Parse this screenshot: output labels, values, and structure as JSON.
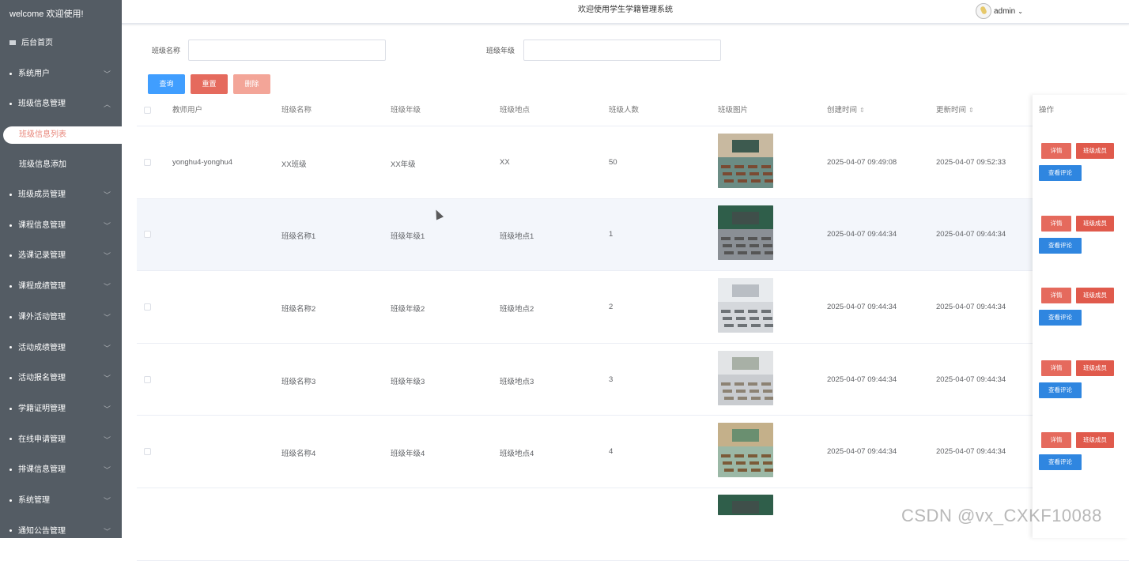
{
  "sidebar": {
    "welcome": "welcome 欢迎使用!",
    "items": [
      {
        "label": "后台首页",
        "icon": "home-icon",
        "expandable": false
      },
      {
        "label": "系统用户",
        "expandable": true,
        "expanded": false
      },
      {
        "label": "班级信息管理",
        "expandable": true,
        "expanded": true,
        "children": [
          {
            "label": "班级信息列表",
            "active": true
          },
          {
            "label": "班级信息添加",
            "active": false
          }
        ]
      },
      {
        "label": "班级成员管理",
        "expandable": true,
        "expanded": false
      },
      {
        "label": "课程信息管理",
        "expandable": true,
        "expanded": false
      },
      {
        "label": "选课记录管理",
        "expandable": true,
        "expanded": false
      },
      {
        "label": "课程成绩管理",
        "expandable": true,
        "expanded": false
      },
      {
        "label": "课外活动管理",
        "expandable": true,
        "expanded": false
      },
      {
        "label": "活动成绩管理",
        "expandable": true,
        "expanded": false
      },
      {
        "label": "活动报名管理",
        "expandable": true,
        "expanded": false
      },
      {
        "label": "学籍证明管理",
        "expandable": true,
        "expanded": false
      },
      {
        "label": "在线申请管理",
        "expandable": true,
        "expanded": false
      },
      {
        "label": "排课信息管理",
        "expandable": true,
        "expanded": false
      },
      {
        "label": "系统管理",
        "expandable": true,
        "expanded": false
      },
      {
        "label": "通知公告管理",
        "expandable": true,
        "expanded": false
      }
    ]
  },
  "header": {
    "title": "欢迎使用学生学籍管理系统",
    "user": "admin"
  },
  "search": {
    "class_name_label": "班级名称",
    "class_name_value": "",
    "class_grade_label": "班级年级",
    "class_grade_value": ""
  },
  "buttons": {
    "query": "查询",
    "reset": "重置",
    "delete": "删除"
  },
  "table": {
    "columns": [
      "教师用户",
      "班级名称",
      "班级年级",
      "班级地点",
      "班级人数",
      "班级图片",
      "创建时间",
      "更新时间",
      "操作"
    ],
    "sortable_columns": [
      "创建时间",
      "更新时间"
    ],
    "row_actions": {
      "detail": "详情",
      "members": "班级成员",
      "review": "查看评论"
    },
    "rows": [
      {
        "teacher": "yonghu4-yonghu4",
        "name": "XX班级",
        "grade": "XX年级",
        "location": "XX",
        "count": "50",
        "created": "2025-04-07 09:49:08",
        "updated": "2025-04-07 09:52:33"
      },
      {
        "teacher": "",
        "name": "班级名称1",
        "grade": "班级年级1",
        "location": "班级地点1",
        "count": "1",
        "created": "2025-04-07 09:44:34",
        "updated": "2025-04-07 09:44:34"
      },
      {
        "teacher": "",
        "name": "班级名称2",
        "grade": "班级年级2",
        "location": "班级地点2",
        "count": "2",
        "created": "2025-04-07 09:44:34",
        "updated": "2025-04-07 09:44:34"
      },
      {
        "teacher": "",
        "name": "班级名称3",
        "grade": "班级年级3",
        "location": "班级地点3",
        "count": "3",
        "created": "2025-04-07 09:44:34",
        "updated": "2025-04-07 09:44:34"
      },
      {
        "teacher": "",
        "name": "班级名称4",
        "grade": "班级年级4",
        "location": "班级地点4",
        "count": "4",
        "created": "2025-04-07 09:44:34",
        "updated": "2025-04-07 09:44:34"
      }
    ]
  },
  "watermark": "CSDN @vx_CXKF10088",
  "colors": {
    "sidebar_bg": "#545c64",
    "active_text": "#e8867a",
    "query_btn": "#409eff",
    "reset_btn": "#e56a5d",
    "delete_btn": "#f3a598",
    "review_btn": "#2f86e0"
  }
}
